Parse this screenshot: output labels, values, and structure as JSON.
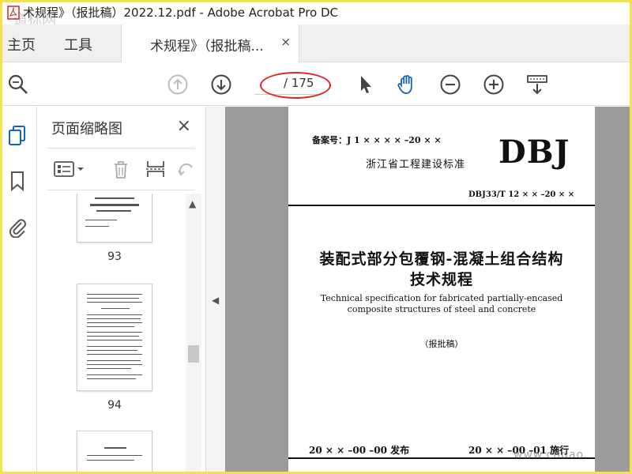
{
  "window": {
    "title": "术规程》（报批稿）2022.12.pdf - Adobe Acrobat Pro DC",
    "watermark_top": "道标网",
    "watermark_bottom": "www.cndao."
  },
  "menu": {
    "home": "主页",
    "tools": "工具",
    "tab_label": "术规程》（报批稿...",
    "tab_close": "×"
  },
  "toolbar": {
    "page_input": "",
    "page_total": "/ 175",
    "icons": [
      "zoom-search-icon",
      "previous-page-icon",
      "next-page-icon",
      "select-arrow-icon",
      "hand-tool-icon",
      "zoom-out-icon",
      "zoom-in-icon",
      "scroll-mode-icon"
    ]
  },
  "panel": {
    "title": "页面缩略图",
    "close": "×",
    "thumbnails": [
      {
        "page": "93"
      },
      {
        "page": "94"
      },
      {
        "page": ""
      }
    ]
  },
  "document": {
    "beian": "备案号：J 1 × × × × –20 × ×",
    "series": "DBJ",
    "org": "浙江省工程建设标准",
    "code": "DBJ33/T 12 × × –20 × ×",
    "title_cn_1": "装配式部分包覆钢-混凝土组合结构",
    "title_cn_2": "技术规程",
    "title_en_1": "Technical specification for fabricated partially-encased",
    "title_en_2": "composite structures of steel and concrete",
    "draft": "（报批稿）",
    "issue_date": "20 × × –00 –00 发布",
    "effective_date": "20 × × –00 –01 施行"
  },
  "colors": {
    "frame": "#f5e24a",
    "annotation_oval": "#e0252a",
    "acrobat_blue": "#1565c0",
    "doc_background": "#9b9b9b"
  }
}
